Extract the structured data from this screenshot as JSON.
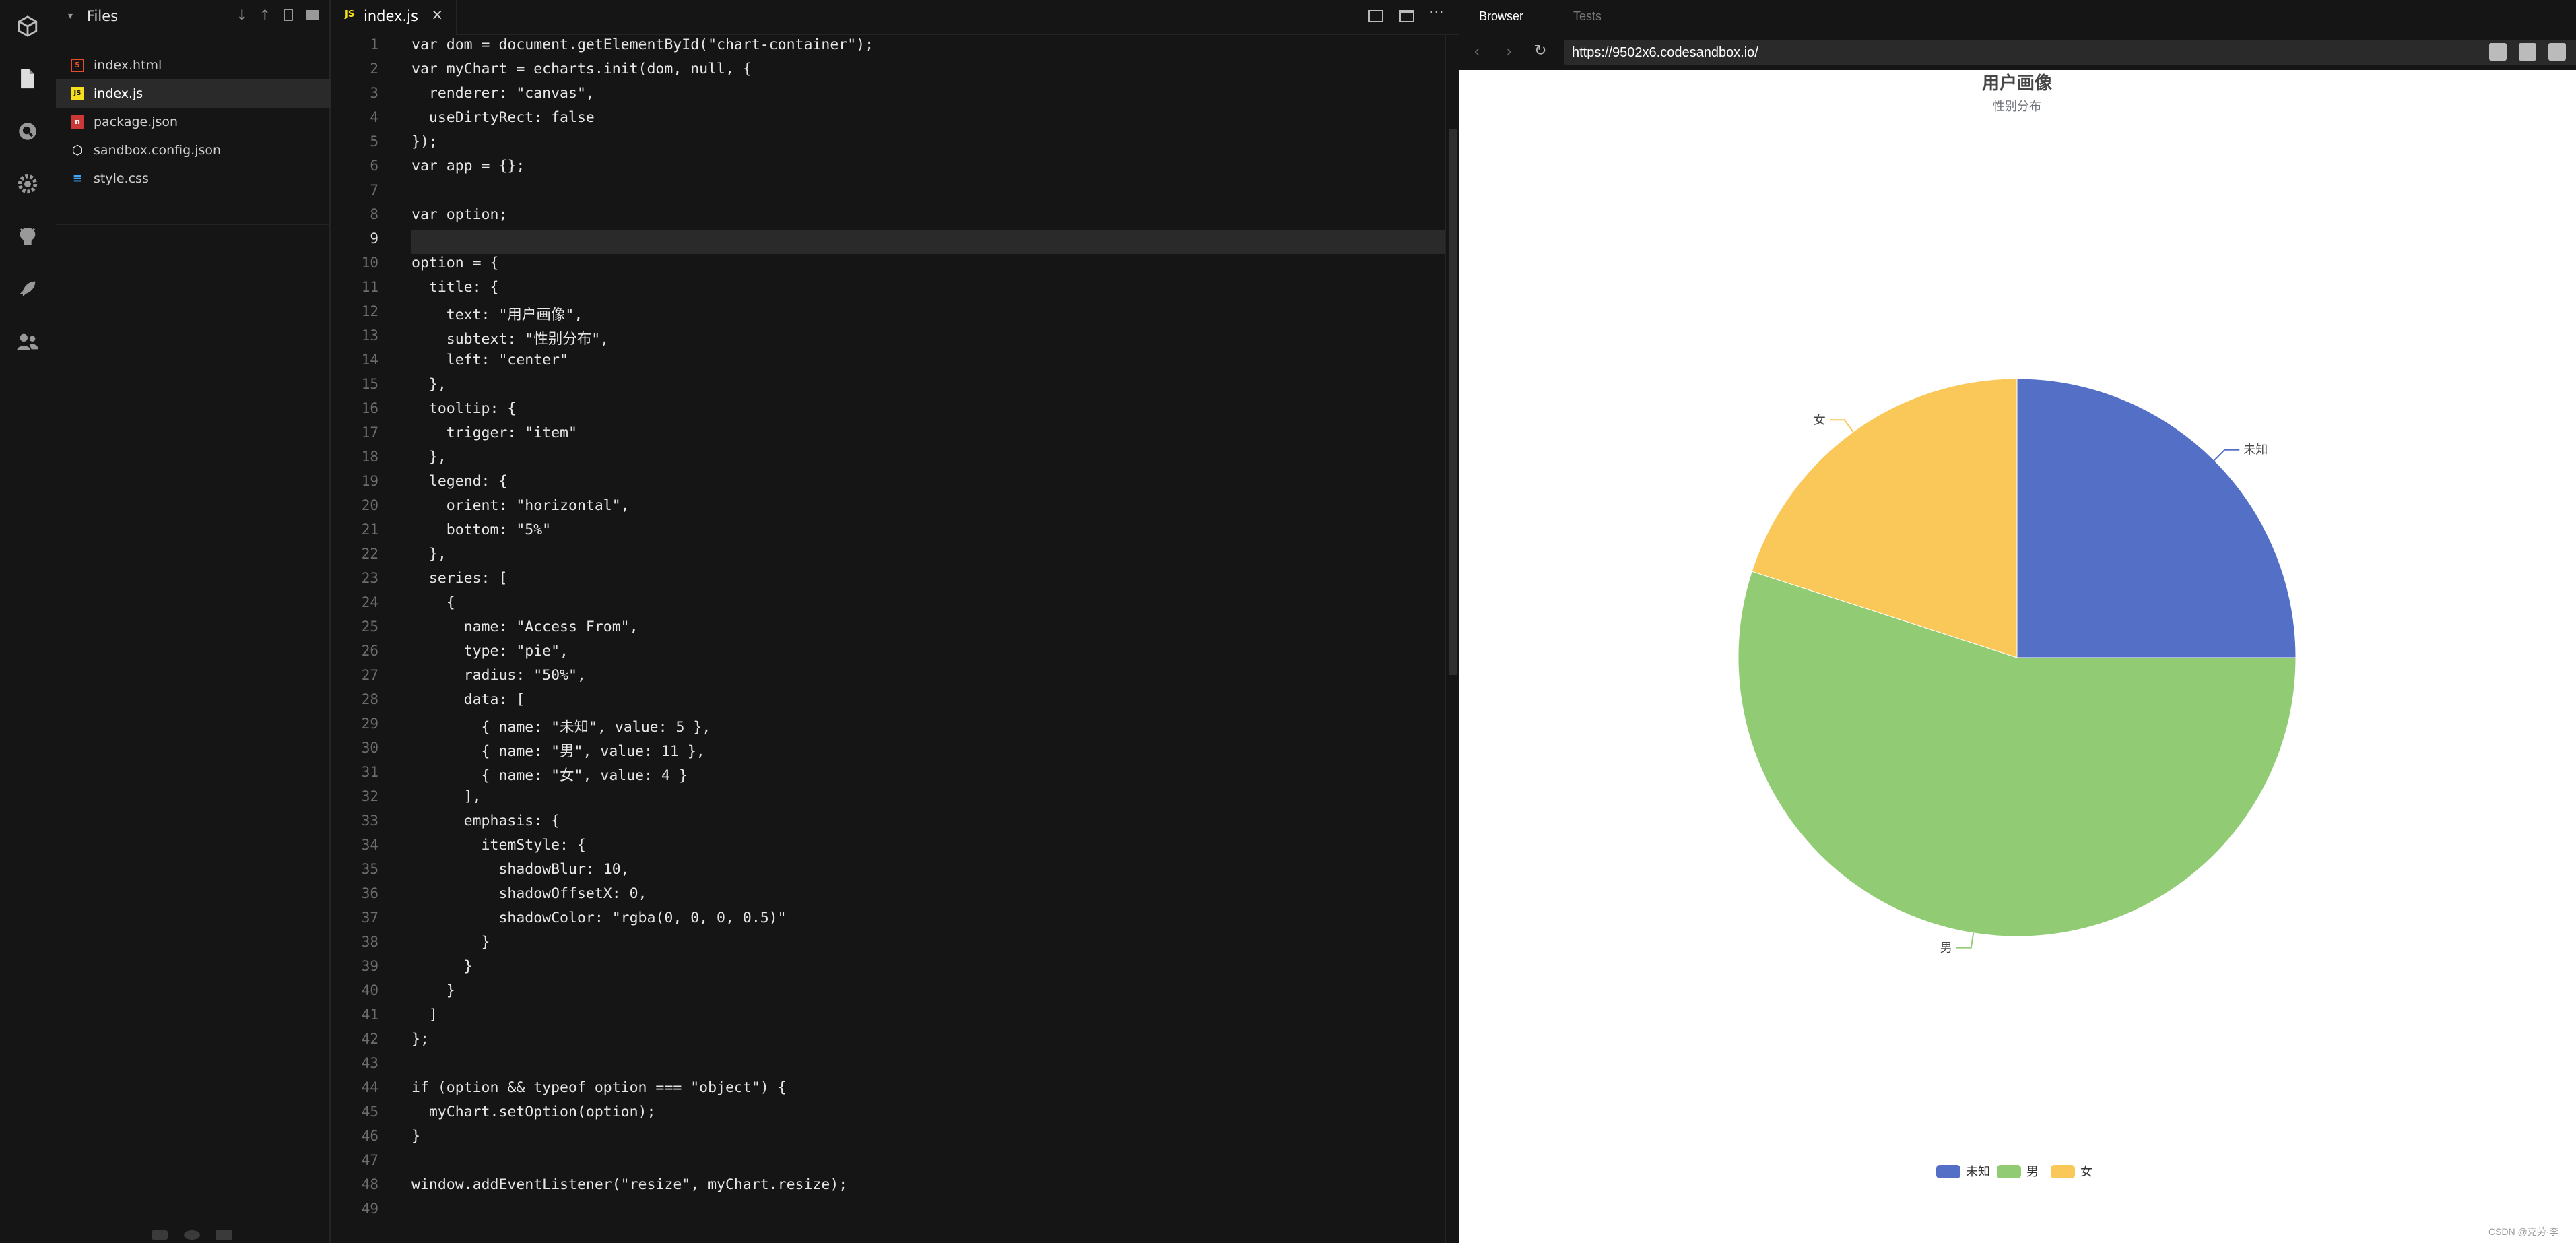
{
  "explorer": {
    "title": "Files",
    "files": [
      {
        "name": "index.html",
        "icon": "html-file-icon",
        "color": "#e44d26",
        "glyph": "5"
      },
      {
        "name": "index.js",
        "icon": "js-file-icon",
        "color": "#f7df1e",
        "glyph": "JS",
        "active": true
      },
      {
        "name": "package.json",
        "icon": "npm-file-icon",
        "color": "#cb3837",
        "glyph": "n"
      },
      {
        "name": "sandbox.config.json",
        "icon": "codesandbox-file-icon",
        "color": "#ffffff",
        "glyph": "⬡"
      },
      {
        "name": "style.css",
        "icon": "css-file-icon",
        "color": "#42a5f5",
        "glyph": "3"
      }
    ]
  },
  "editor": {
    "tab_label": "index.js",
    "tab_icon": "JS",
    "line_numbers": [
      "1",
      "2",
      "3",
      "4",
      "5",
      "6",
      "7",
      "8",
      "9",
      "10",
      "11",
      "12",
      "13",
      "14",
      "15",
      "16",
      "17",
      "18",
      "19",
      "20",
      "21",
      "22",
      "23",
      "24",
      "25",
      "26",
      "27",
      "28",
      "29",
      "30",
      "31",
      "32",
      "33",
      "34",
      "35",
      "36",
      "37",
      "38",
      "39",
      "40",
      "41",
      "42",
      "43",
      "44",
      "45",
      "46",
      "47",
      "48",
      "49"
    ],
    "lines": [
      "var dom = document.getElementById(\"chart-container\");",
      "var myChart = echarts.init(dom, null, {",
      "  renderer: \"canvas\",",
      "  useDirtyRect: false",
      "});",
      "var app = {};",
      "",
      "var option;",
      "",
      "option = {",
      "  title: {",
      "    text: \"用户画像\",",
      "    subtext: \"性别分布\",",
      "    left: \"center\"",
      "  },",
      "  tooltip: {",
      "    trigger: \"item\"",
      "  },",
      "  legend: {",
      "    orient: \"horizontal\",",
      "    bottom: \"5%\"",
      "  },",
      "  series: [",
      "    {",
      "      name: \"Access From\",",
      "      type: \"pie\",",
      "      radius: \"50%\",",
      "      data: [",
      "        { name: \"未知\", value: 5 },",
      "        { name: \"男\", value: 11 },",
      "        { name: \"女\", value: 4 }",
      "      ],",
      "      emphasis: {",
      "        itemStyle: {",
      "          shadowBlur: 10,",
      "          shadowOffsetX: 0,",
      "          shadowColor: \"rgba(0, 0, 0, 0.5)\"",
      "        }",
      "      }",
      "    }",
      "  ]",
      "};",
      "",
      "if (option && typeof option === \"object\") {",
      "  myChart.setOption(option);",
      "}",
      "",
      "window.addEventListener(\"resize\", myChart.resize);",
      ""
    ]
  },
  "preview": {
    "tabs": [
      "Browser",
      "Tests"
    ],
    "url": "https://9502x6.codesandbox.io/"
  },
  "chart_data": {
    "type": "pie",
    "title": "用户画像",
    "subtitle": "性别分布",
    "categories": [
      "未知",
      "男",
      "女"
    ],
    "values": [
      5,
      11,
      4
    ],
    "colors": [
      "#5470c6",
      "#91cc75",
      "#fac858"
    ],
    "legend_position": "bottom-center"
  },
  "watermark": "CSDN @克劳·李"
}
